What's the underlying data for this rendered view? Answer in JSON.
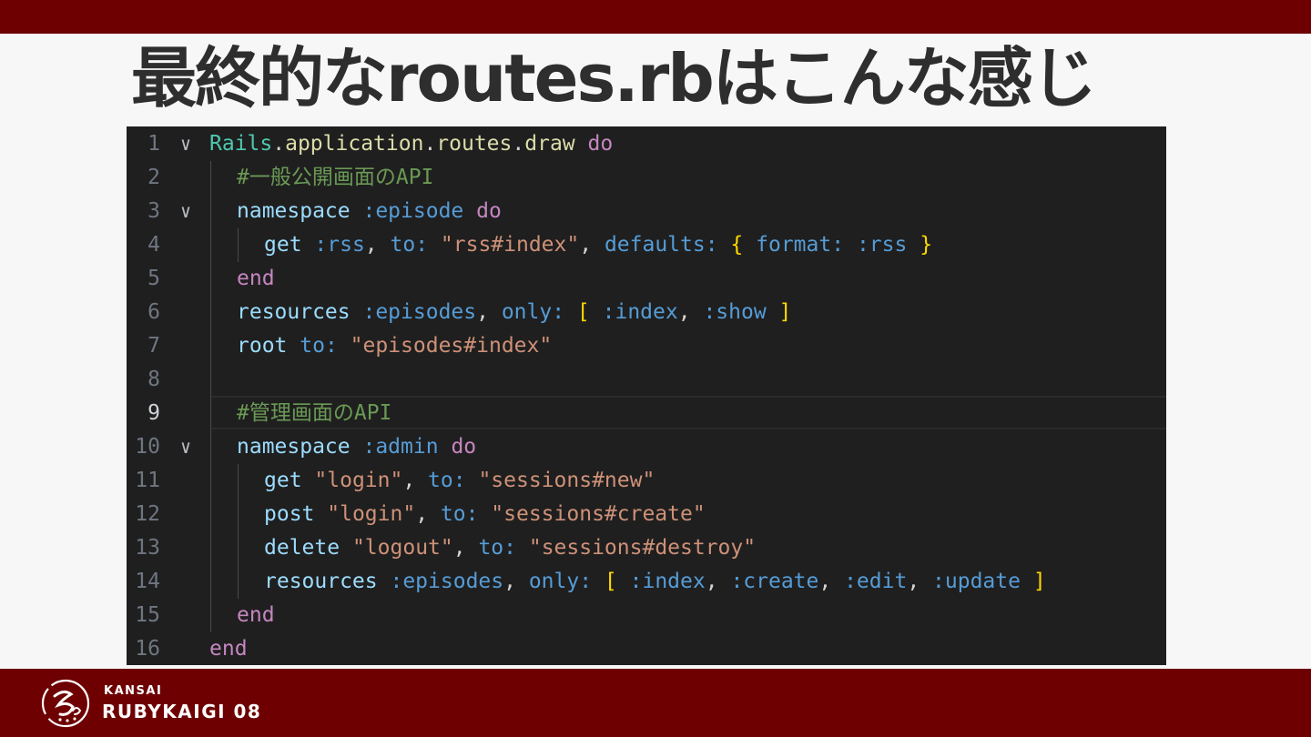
{
  "slide": {
    "title": "最終的なroutes.rbはこんな感じ"
  },
  "editor": {
    "active_line": 9,
    "lines": [
      {
        "n": "1",
        "fold": true,
        "indent": 0,
        "tokens": [
          [
            "Rails",
            "const"
          ],
          [
            ".",
            "plain"
          ],
          [
            "application",
            "fn"
          ],
          [
            ".",
            "plain"
          ],
          [
            "routes",
            "fn"
          ],
          [
            ".",
            "plain"
          ],
          [
            "draw",
            "fn"
          ],
          [
            " ",
            "plain"
          ],
          [
            "do",
            "kw"
          ]
        ]
      },
      {
        "n": "2",
        "fold": false,
        "indent": 1,
        "tokens": [
          [
            "#一般公開画面のAPI",
            "cmt"
          ]
        ]
      },
      {
        "n": "3",
        "fold": true,
        "indent": 1,
        "tokens": [
          [
            "namespace",
            "meth"
          ],
          [
            " ",
            "plain"
          ],
          [
            ":episode",
            "sym"
          ],
          [
            " ",
            "plain"
          ],
          [
            "do",
            "kw"
          ]
        ]
      },
      {
        "n": "4",
        "fold": false,
        "indent": 2,
        "tokens": [
          [
            "get",
            "meth"
          ],
          [
            " ",
            "plain"
          ],
          [
            ":rss",
            "sym"
          ],
          [
            ", ",
            "plain"
          ],
          [
            "to:",
            "key"
          ],
          [
            " ",
            "plain"
          ],
          [
            "\"rss#index\"",
            "str"
          ],
          [
            ", ",
            "plain"
          ],
          [
            "defaults:",
            "key"
          ],
          [
            " ",
            "plain"
          ],
          [
            "{",
            "br"
          ],
          [
            " ",
            "plain"
          ],
          [
            "format:",
            "key"
          ],
          [
            " ",
            "plain"
          ],
          [
            ":rss",
            "sym"
          ],
          [
            " ",
            "plain"
          ],
          [
            "}",
            "br"
          ]
        ]
      },
      {
        "n": "5",
        "fold": false,
        "indent": 1,
        "tokens": [
          [
            "end",
            "kw"
          ]
        ]
      },
      {
        "n": "6",
        "fold": false,
        "indent": 1,
        "tokens": [
          [
            "resources",
            "meth"
          ],
          [
            " ",
            "plain"
          ],
          [
            ":episodes",
            "sym"
          ],
          [
            ", ",
            "plain"
          ],
          [
            "only:",
            "key"
          ],
          [
            " ",
            "plain"
          ],
          [
            "[",
            "br"
          ],
          [
            " ",
            "plain"
          ],
          [
            ":index",
            "sym"
          ],
          [
            ", ",
            "plain"
          ],
          [
            ":show",
            "sym"
          ],
          [
            " ",
            "plain"
          ],
          [
            "]",
            "br"
          ]
        ]
      },
      {
        "n": "7",
        "fold": false,
        "indent": 1,
        "tokens": [
          [
            "root",
            "meth"
          ],
          [
            " ",
            "plain"
          ],
          [
            "to:",
            "key"
          ],
          [
            " ",
            "plain"
          ],
          [
            "\"episodes#index\"",
            "str"
          ]
        ]
      },
      {
        "n": "8",
        "fold": false,
        "indent": 1,
        "tokens": []
      },
      {
        "n": "9",
        "fold": false,
        "indent": 1,
        "tokens": [
          [
            "#管理画面のAPI",
            "cmt"
          ]
        ]
      },
      {
        "n": "10",
        "fold": true,
        "indent": 1,
        "tokens": [
          [
            "namespace",
            "meth"
          ],
          [
            " ",
            "plain"
          ],
          [
            ":admin",
            "sym"
          ],
          [
            " ",
            "plain"
          ],
          [
            "do",
            "kw"
          ]
        ]
      },
      {
        "n": "11",
        "fold": false,
        "indent": 2,
        "tokens": [
          [
            "get",
            "meth"
          ],
          [
            " ",
            "plain"
          ],
          [
            "\"login\"",
            "str"
          ],
          [
            ", ",
            "plain"
          ],
          [
            "to:",
            "key"
          ],
          [
            " ",
            "plain"
          ],
          [
            "\"sessions#new\"",
            "str"
          ]
        ]
      },
      {
        "n": "12",
        "fold": false,
        "indent": 2,
        "tokens": [
          [
            "post",
            "meth"
          ],
          [
            " ",
            "plain"
          ],
          [
            "\"login\"",
            "str"
          ],
          [
            ", ",
            "plain"
          ],
          [
            "to:",
            "key"
          ],
          [
            " ",
            "plain"
          ],
          [
            "\"sessions#create\"",
            "str"
          ]
        ]
      },
      {
        "n": "13",
        "fold": false,
        "indent": 2,
        "tokens": [
          [
            "delete",
            "meth"
          ],
          [
            " ",
            "plain"
          ],
          [
            "\"logout\"",
            "str"
          ],
          [
            ", ",
            "plain"
          ],
          [
            "to:",
            "key"
          ],
          [
            " ",
            "plain"
          ],
          [
            "\"sessions#destroy\"",
            "str"
          ]
        ]
      },
      {
        "n": "14",
        "fold": false,
        "indent": 2,
        "tokens": [
          [
            "resources",
            "meth"
          ],
          [
            " ",
            "plain"
          ],
          [
            ":episodes",
            "sym"
          ],
          [
            ", ",
            "plain"
          ],
          [
            "only:",
            "key"
          ],
          [
            " ",
            "plain"
          ],
          [
            "[",
            "br"
          ],
          [
            " ",
            "plain"
          ],
          [
            ":index",
            "sym"
          ],
          [
            ", ",
            "plain"
          ],
          [
            ":create",
            "sym"
          ],
          [
            ", ",
            "plain"
          ],
          [
            ":edit",
            "sym"
          ],
          [
            ", ",
            "plain"
          ],
          [
            ":update",
            "sym"
          ],
          [
            " ",
            "plain"
          ],
          [
            "]",
            "br"
          ]
        ]
      },
      {
        "n": "15",
        "fold": false,
        "indent": 1,
        "tokens": [
          [
            "end",
            "kw"
          ]
        ]
      },
      {
        "n": "16",
        "fold": false,
        "indent": 0,
        "tokens": [
          [
            "end",
            "kw"
          ]
        ]
      }
    ]
  },
  "footer": {
    "logo_small": "KANSAI",
    "logo_big": "RUBYKAIGI 08",
    "brand_color": "#6e0002"
  }
}
